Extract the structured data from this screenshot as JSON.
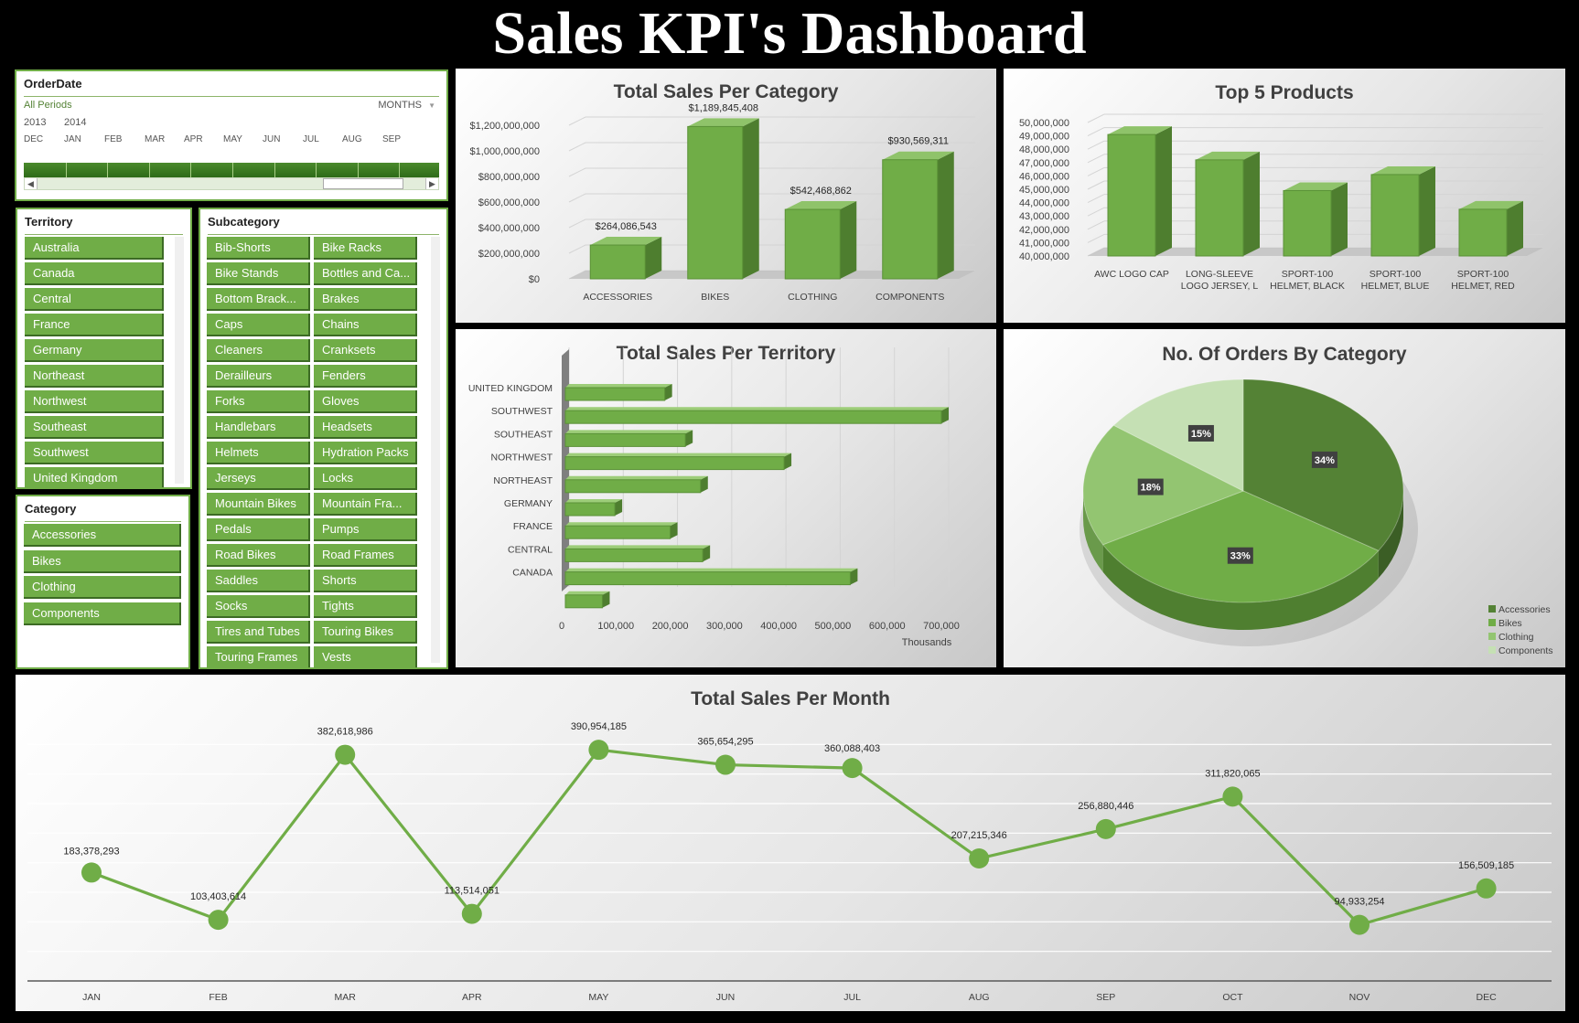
{
  "dashboard": {
    "title": "Sales KPI's Dashboard"
  },
  "timeline": {
    "title": "OrderDate",
    "periods_label": "All Periods",
    "unit_label": "MONTHS",
    "years": [
      "2013",
      "2014"
    ],
    "months": [
      "DEC",
      "JAN",
      "FEB",
      "MAR",
      "APR",
      "MAY",
      "JUN",
      "JUL",
      "AUG",
      "SEP"
    ]
  },
  "slicers": {
    "territory": {
      "title": "Territory",
      "items": [
        "Australia",
        "Canada",
        "Central",
        "France",
        "Germany",
        "Northeast",
        "Northwest",
        "Southeast",
        "Southwest",
        "United Kingdom"
      ]
    },
    "subcategory": {
      "title": "Subcategory",
      "items": [
        "Bib-Shorts",
        "Bike Racks",
        "Bike Stands",
        "Bottles and Ca...",
        "Bottom Brack...",
        "Brakes",
        "Caps",
        "Chains",
        "Cleaners",
        "Cranksets",
        "Derailleurs",
        "Fenders",
        "Forks",
        "Gloves",
        "Handlebars",
        "Headsets",
        "Helmets",
        "Hydration Packs",
        "Jerseys",
        "Locks",
        "Mountain Bikes",
        "Mountain Fra...",
        "Pedals",
        "Pumps",
        "Road Bikes",
        "Road Frames",
        "Saddles",
        "Shorts",
        "Socks",
        "Tights",
        "Tires and Tubes",
        "Touring Bikes",
        "Touring Frames",
        "Vests"
      ]
    },
    "category": {
      "title": "Category",
      "items": [
        "Accessories",
        "Bikes",
        "Clothing",
        "Components"
      ]
    }
  },
  "colors": {
    "green": "#70ad47",
    "green_light": "#a9d18e",
    "green_dark": "#548235",
    "green_pale": "#c5e0b4",
    "text": "#404040"
  },
  "chart_data": [
    {
      "id": "sales-per-category",
      "type": "bar",
      "title": "Total Sales Per Category",
      "categories": [
        "ACCESSORIES",
        "BIKES",
        "CLOTHING",
        "COMPONENTS"
      ],
      "values": [
        264086543,
        1189845408,
        542468862,
        930569311
      ],
      "value_labels": [
        "$264,086,543",
        "$1,189,845,408",
        "$542,468,862",
        "$930,569,311"
      ],
      "yticks": [
        "$0",
        "$200,000,000",
        "$400,000,000",
        "$600,000,000",
        "$800,000,000",
        "$1,000,000,000",
        "$1,200,000,000"
      ],
      "ylim": [
        0,
        1200000000
      ]
    },
    {
      "id": "top-5-products",
      "type": "bar",
      "title": "Top 5 Products",
      "categories": [
        [
          "AWC LOGO CAP"
        ],
        [
          "LONG-SLEEVE",
          "LOGO JERSEY, L"
        ],
        [
          "SPORT-100",
          "HELMET, BLACK"
        ],
        [
          "SPORT-100",
          "HELMET, BLUE"
        ],
        [
          "SPORT-100",
          "HELMET, RED"
        ]
      ],
      "values": [
        49100000,
        47200000,
        44900000,
        46100000,
        43500000
      ],
      "yticks": [
        "40,000,000",
        "41,000,000",
        "42,000,000",
        "43,000,000",
        "44,000,000",
        "45,000,000",
        "46,000,000",
        "47,000,000",
        "48,000,000",
        "49,000,000",
        "50,000,000"
      ],
      "ylim": [
        40000000,
        50000000
      ]
    },
    {
      "id": "sales-per-territory",
      "type": "bar",
      "orientation": "horizontal",
      "title": "Total Sales Per Territory",
      "categories": [
        "UNITED KINGDOM",
        "SOUTHWEST",
        "SOUTHEAST",
        "NORTHWEST",
        "NORTHEAST",
        "GERMANY",
        "FRANCE",
        "CENTRAL",
        "CANADA",
        ""
      ],
      "values": [
        190000,
        700000,
        228000,
        410000,
        256000,
        98000,
        200000,
        260000,
        532000,
        75000
      ],
      "xticks": [
        "0",
        "100,000",
        "200,000",
        "300,000",
        "400,000",
        "500,000",
        "600,000",
        "700,000"
      ],
      "xlim": [
        0,
        700000
      ],
      "xlabel": "Thousands"
    },
    {
      "id": "orders-by-category",
      "type": "pie",
      "title": "No. Of Orders By Category",
      "labels": [
        "Accessories",
        "Bikes",
        "Clothing",
        "Components"
      ],
      "values": [
        34,
        33,
        18,
        15
      ],
      "value_labels": [
        "34%",
        "33%",
        "18%",
        "15%"
      ],
      "legend": "bottom-right"
    },
    {
      "id": "sales-per-month",
      "type": "line",
      "title": "Total Sales Per Month",
      "categories": [
        "JAN",
        "FEB",
        "MAR",
        "APR",
        "MAY",
        "JUN",
        "JUL",
        "AUG",
        "SEP",
        "OCT",
        "NOV",
        "DEC"
      ],
      "values": [
        183378293,
        103403614,
        382618986,
        113514051,
        390954185,
        365654295,
        360088403,
        207215346,
        256880446,
        311820065,
        94933254,
        156509185
      ],
      "value_labels": [
        "183,378,293",
        "103,403,614",
        "382,618,986",
        "113,514,051",
        "390,954,185",
        "365,654,295",
        "360,088,403",
        "207,215,346",
        "256,880,446",
        "311,820,065",
        "94,933,254",
        "156,509,185"
      ],
      "ylim": [
        0,
        450000000
      ],
      "grid": true
    }
  ]
}
